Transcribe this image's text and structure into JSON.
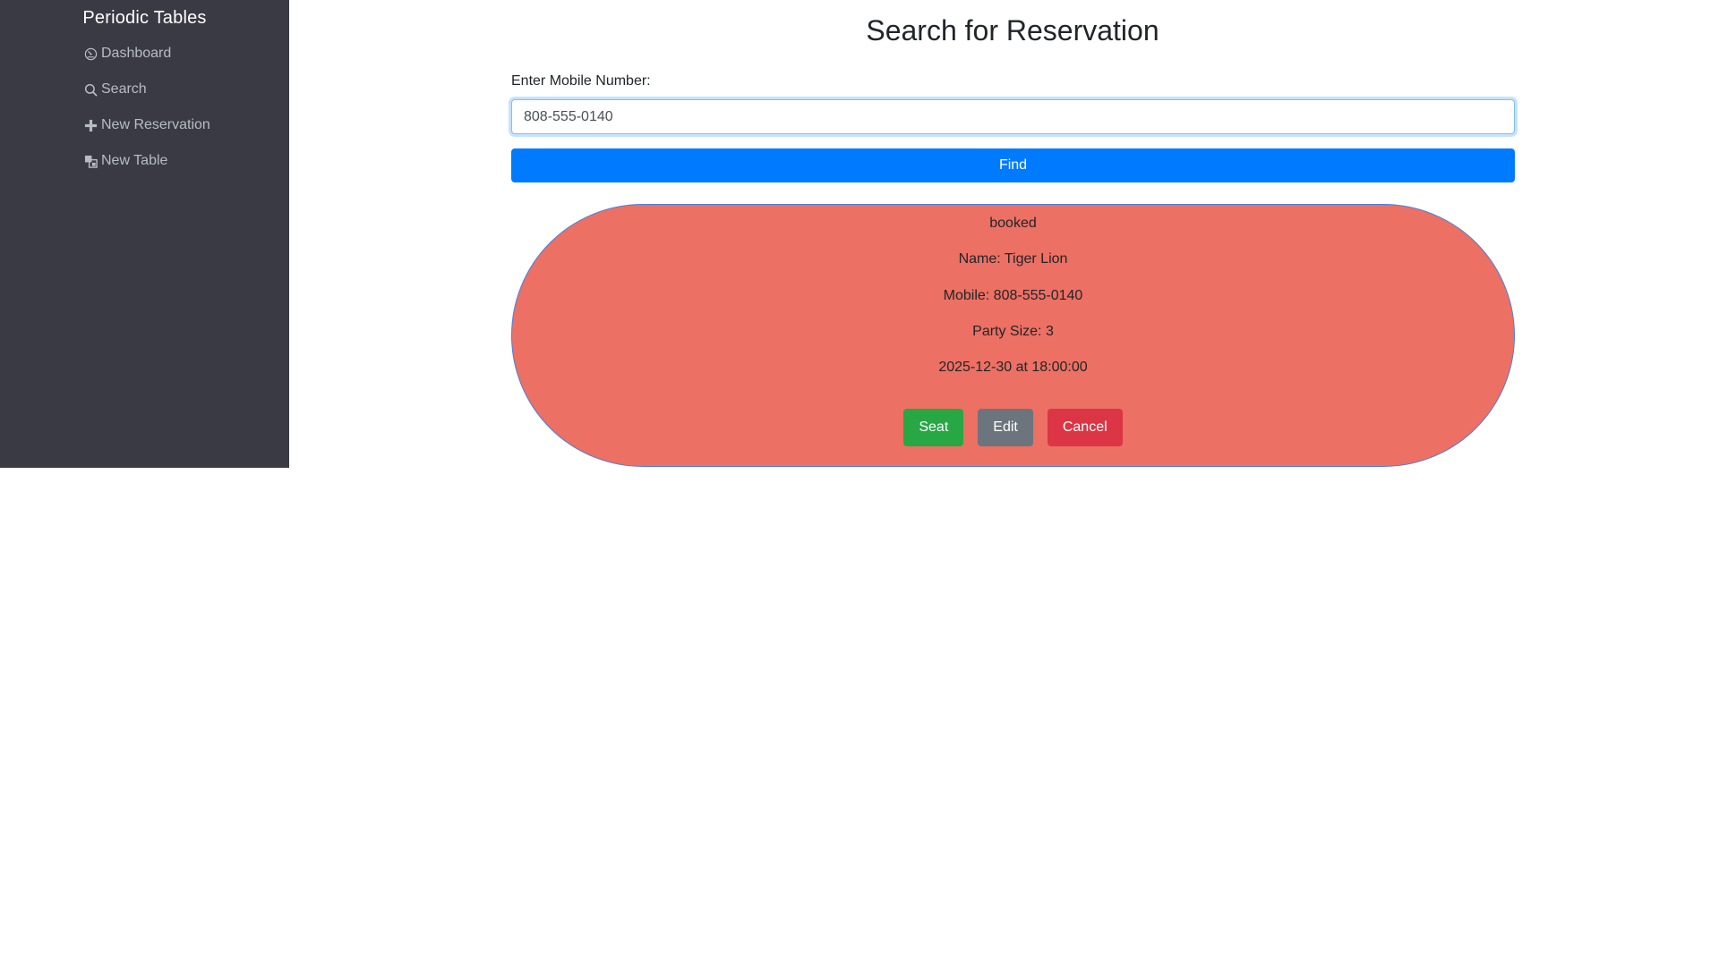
{
  "sidebar": {
    "brand": "Periodic Tables",
    "items": [
      {
        "label": "Dashboard",
        "icon": "dashboard-icon"
      },
      {
        "label": "Search",
        "icon": "search-icon"
      },
      {
        "label": "New Reservation",
        "icon": "plus-icon"
      },
      {
        "label": "New Table",
        "icon": "layers-icon"
      }
    ]
  },
  "main": {
    "title": "Search for Reservation",
    "search": {
      "label": "Enter Mobile Number:",
      "value": "808-555-0140",
      "button_label": "Find"
    },
    "reservation": {
      "status": "booked",
      "name": "Name: Tiger Lion",
      "mobile": "Mobile: 808-555-0140",
      "party_size": "Party Size: 3",
      "datetime": "2025-12-30 at 18:00:00",
      "actions": {
        "seat": "Seat",
        "edit": "Edit",
        "cancel": "Cancel"
      }
    }
  },
  "colors": {
    "sidebar_bg": "#3a3a45",
    "card_bg": "#ec7063",
    "primary": "#007bff",
    "success": "#28a745",
    "secondary": "#6c757d",
    "danger": "#dc3545"
  }
}
